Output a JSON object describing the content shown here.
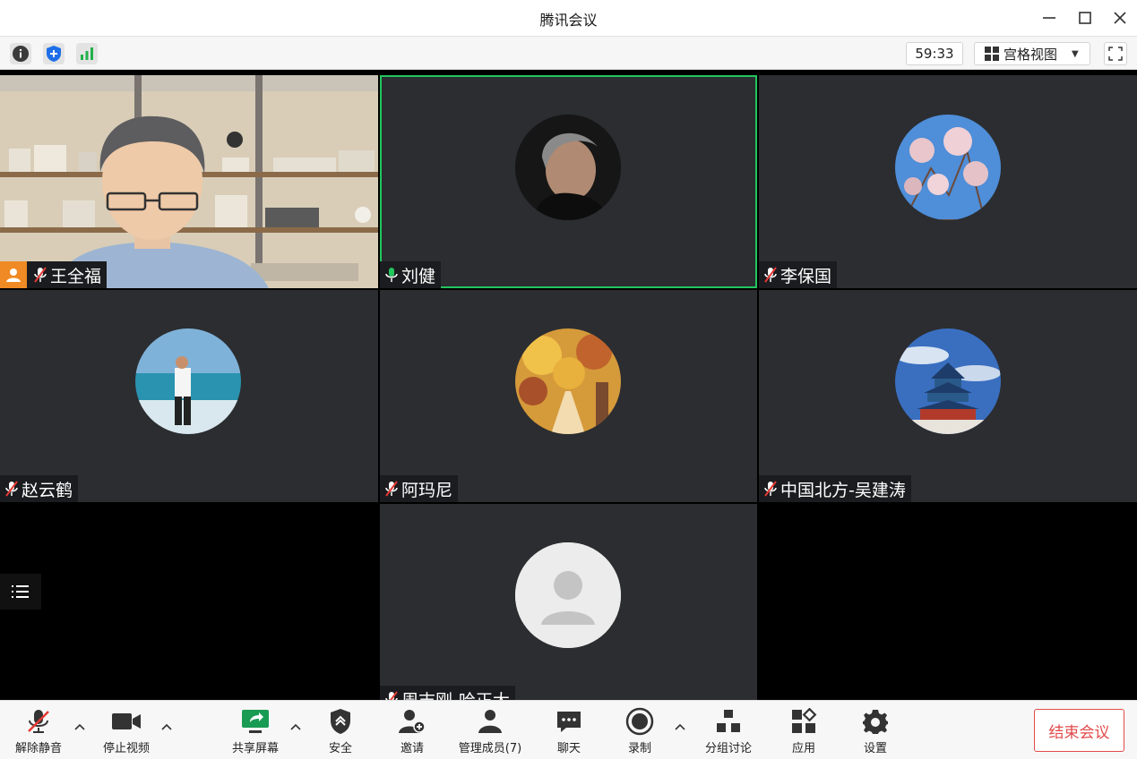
{
  "window": {
    "title": "腾讯会议"
  },
  "infobar": {
    "timer": "59:33",
    "view_label": "宫格视图"
  },
  "participants": [
    {
      "name": "王全福",
      "mic": "muted",
      "avatar": "video-feed",
      "host": true
    },
    {
      "name": "刘健",
      "mic": "active",
      "avatar": "photo-portrait",
      "speaking": true
    },
    {
      "name": "李保国",
      "mic": "muted",
      "avatar": "photo-blossom"
    },
    {
      "name": "赵云鹤",
      "mic": "muted",
      "avatar": "photo-beach"
    },
    {
      "name": "阿玛尼",
      "mic": "muted",
      "avatar": "photo-autumn"
    },
    {
      "name": "中国北方-吴建涛",
      "mic": "muted",
      "avatar": "photo-temple"
    },
    {
      "name": "周志刚-哈正大",
      "mic": "muted",
      "avatar": "default-user-icon"
    }
  ],
  "toolbar": {
    "unmute": "解除静音",
    "stop_video": "停止视频",
    "share_screen": "共享屏幕",
    "security": "安全",
    "invite": "邀请",
    "manage_members": "管理成员(7)",
    "chat": "聊天",
    "record": "录制",
    "breakout": "分组讨论",
    "apps": "应用",
    "settings": "设置",
    "end_meeting": "结束会议"
  },
  "colors": {
    "active_speaker": "#22c55e",
    "end_button": "#e24a4a",
    "host_badge": "#f08a24",
    "tile_bg": "#2b2d31"
  }
}
